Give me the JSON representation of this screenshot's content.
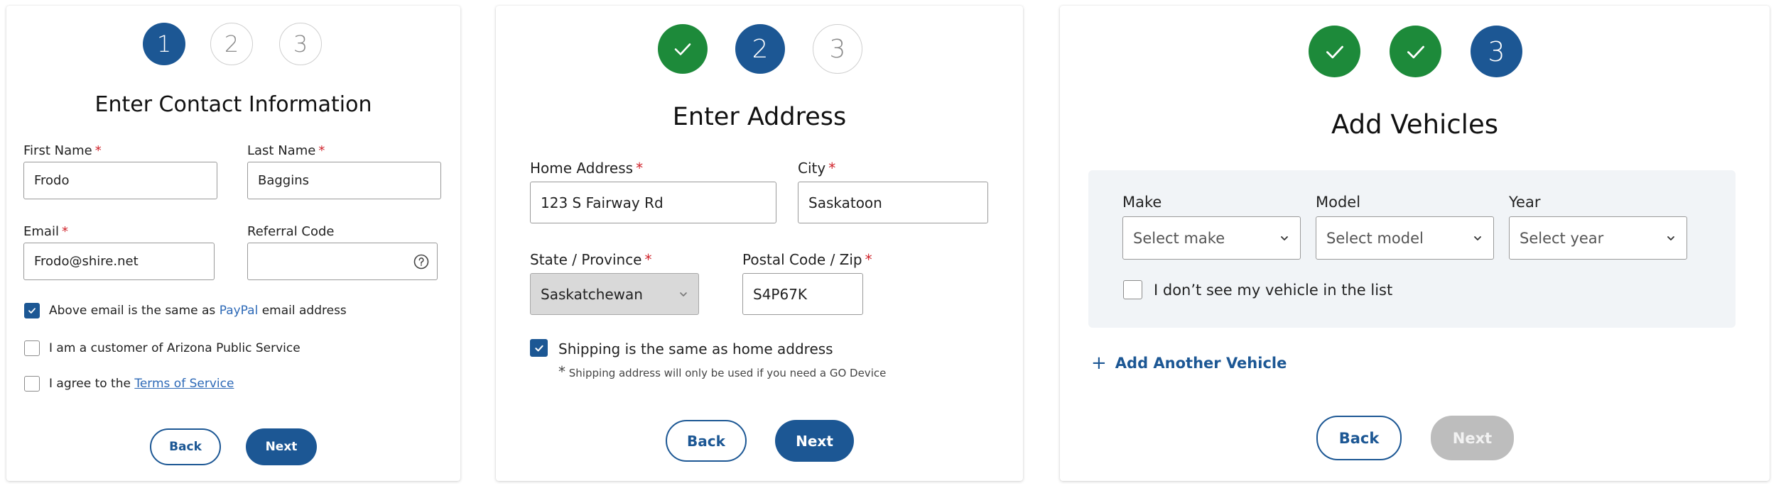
{
  "card1": {
    "steps": [
      "1",
      "2",
      "3"
    ],
    "title": "Enter Contact Information",
    "first_name": {
      "label": "First Name",
      "required": "*",
      "value": "Frodo"
    },
    "last_name": {
      "label": "Last Name",
      "required": "*",
      "value": "Baggins"
    },
    "email": {
      "label": "Email",
      "required": "*",
      "value": "Frodo@shire.net"
    },
    "referral": {
      "label": "Referral Code",
      "value": ""
    },
    "check_paypal": {
      "checked": true,
      "text_before": "Above email is the same as",
      "link": "PayPal",
      "text_after": "email address"
    },
    "check_aps": {
      "checked": false,
      "text": "I am a customer of Arizona Public Service"
    },
    "check_terms": {
      "checked": false,
      "text_before": "I agree to the",
      "link": "Terms of Service"
    },
    "back_label": "Back",
    "next_label": "Next"
  },
  "card2": {
    "steps": [
      "2",
      "3"
    ],
    "title": "Enter Address",
    "home_address": {
      "label": "Home Address",
      "required": "*",
      "value": "123 S Fairway Rd"
    },
    "city": {
      "label": "City",
      "required": "*",
      "value": "Saskatoon"
    },
    "state": {
      "label": "State / Province",
      "required": "*",
      "value": "Saskatchewan"
    },
    "postal": {
      "label": "Postal Code / Zip",
      "required": "*",
      "value": "S4P67K"
    },
    "check_shipping": {
      "checked": true,
      "text": "Shipping is the same as home address"
    },
    "note_star": "*",
    "note": "Shipping address will only be used if you need a GO Device",
    "back_label": "Back",
    "next_label": "Next"
  },
  "card3": {
    "steps": [
      "3"
    ],
    "title": "Add Vehicles",
    "make": {
      "label": "Make",
      "placeholder": "Select make"
    },
    "model": {
      "label": "Model",
      "placeholder": "Select model"
    },
    "year": {
      "label": "Year",
      "placeholder": "Select year"
    },
    "check_missing": {
      "checked": false,
      "text": "I don’t see my vehicle in the list"
    },
    "add_plus": "+",
    "add_label": "Add Another Vehicle",
    "back_label": "Back",
    "next_label": "Next"
  },
  "colors": {
    "primary": "#1c5794",
    "success": "#1d8a3a",
    "required": "#d0232b",
    "link": "#2d69b7",
    "disabled": "#bdbdbd"
  }
}
